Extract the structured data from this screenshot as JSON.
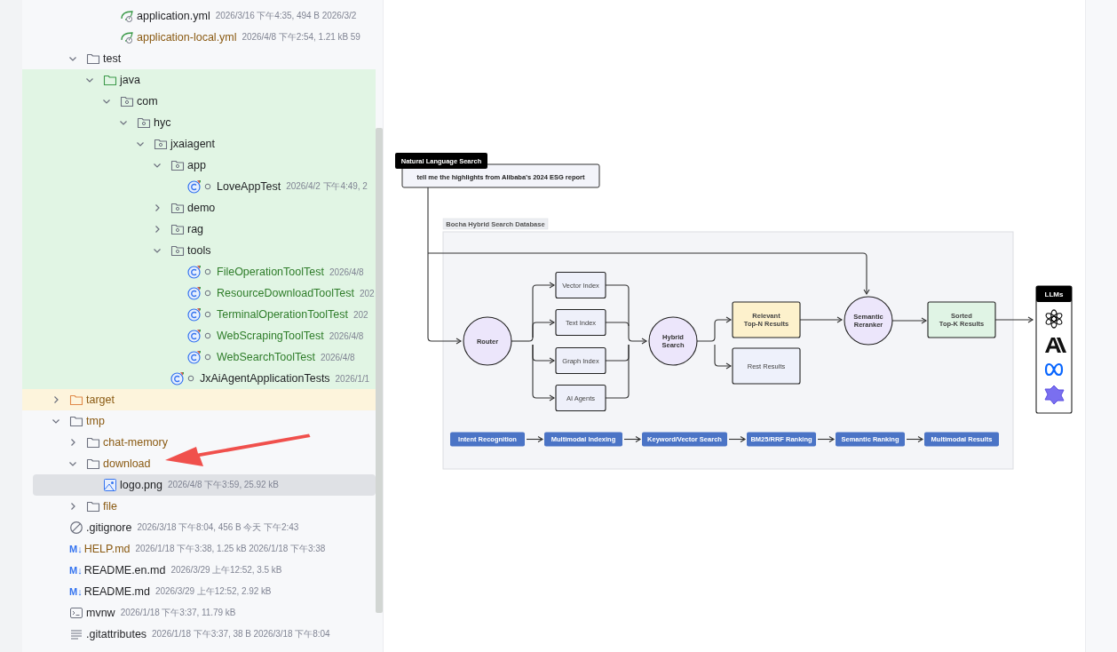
{
  "tree": [
    {
      "children": [
        {
          "children": [
            {
              "children": [
                {
                  "name": "application.yml",
                  "kind": "spring-config",
                  "color": "#1e1f22",
                  "info": "2026/3/16 下午4:35, 494 B 2026/3/2",
                  "selected": false
                },
                {
                  "name": "application-local.yml",
                  "kind": "spring-config",
                  "color": "#8a5a12",
                  "info": "2026/4/8 下午2:54, 1.21 kB 59",
                  "selected": false
                }
              ]
            }
          ]
        },
        {
          "name": "test",
          "kind": "folder",
          "color": "#1e1f22",
          "expanded": true,
          "selected": false,
          "children": [
            {
              "name": "java",
              "kind": "test-root",
              "color": "#1e1f22",
              "expanded": true,
              "selected": false,
              "children": [
                {
                  "name": "com",
                  "kind": "package",
                  "color": "#1e1f22",
                  "expanded": true,
                  "selected": false,
                  "children": [
                    {
                      "name": "hyc",
                      "kind": "package",
                      "color": "#1e1f22",
                      "expanded": true,
                      "selected": false,
                      "children": [
                        {
                          "name": "jxaiagent",
                          "kind": "package",
                          "color": "#1e1f22",
                          "expanded": true,
                          "selected": false,
                          "children": [
                            {
                              "name": "app",
                              "kind": "package",
                              "color": "#1e1f22",
                              "expanded": true,
                              "selected": false,
                              "children": [
                                {
                                  "name": "LoveAppTest",
                                  "kind": "test-class",
                                  "color": "#1e1f22",
                                  "info": "2026/4/2 下午4:49, 2",
                                  "selected": false
                                }
                              ]
                            },
                            {
                              "name": "demo",
                              "kind": "package",
                              "color": "#1e1f22",
                              "expanded": false,
                              "selected": false
                            },
                            {
                              "name": "rag",
                              "kind": "package",
                              "color": "#1e1f22",
                              "expanded": false,
                              "selected": false
                            },
                            {
                              "name": "tools",
                              "kind": "package",
                              "color": "#1e1f22",
                              "expanded": true,
                              "selected": false,
                              "children": [
                                {
                                  "name": "FileOperationToolTest",
                                  "kind": "test-class",
                                  "color": "#2f7d2a",
                                  "info": "2026/4/8",
                                  "selected": false
                                },
                                {
                                  "name": "ResourceDownloadToolTest",
                                  "kind": "test-class",
                                  "color": "#2f7d2a",
                                  "info": "202",
                                  "selected": false
                                },
                                {
                                  "name": "TerminalOperationToolTest",
                                  "kind": "test-class",
                                  "color": "#2f7d2a",
                                  "info": "202",
                                  "selected": false
                                },
                                {
                                  "name": "WebScrapingToolTest",
                                  "kind": "test-class",
                                  "color": "#2f7d2a",
                                  "info": "2026/4/8",
                                  "selected": false
                                },
                                {
                                  "name": "WebSearchToolTest",
                                  "kind": "test-class",
                                  "color": "#2f7d2a",
                                  "info": "2026/4/8",
                                  "selected": false
                                }
                              ]
                            },
                            {
                              "name": "JxAiAgentApplicationTests",
                              "kind": "test-class",
                              "color": "#1e1f22",
                              "info": "2026/1/1",
                              "selected": false
                            }
                          ]
                        }
                      ]
                    }
                  ]
                }
              ]
            }
          ]
        }
      ]
    },
    {
      "name": "target",
      "kind": "excluded-folder",
      "color": "#8a5a12",
      "expanded": false,
      "selected": false
    },
    {
      "name": "tmp",
      "kind": "folder",
      "color": "#8a5a12",
      "expanded": true,
      "selected": false,
      "children": [
        {
          "name": "chat-memory",
          "kind": "folder",
          "color": "#8a5a12",
          "expanded": false,
          "selected": false
        },
        {
          "name": "download",
          "kind": "folder",
          "color": "#8a5a12",
          "expanded": true,
          "selected": false,
          "children": [
            {
              "name": "logo.png",
              "kind": "image",
              "color": "#1e1f22",
              "info": "2026/4/8 下午3:59, 25.92 kB",
              "selected": true
            }
          ]
        },
        {
          "name": "file",
          "kind": "folder",
          "color": "#8a5a12",
          "expanded": false,
          "selected": false
        }
      ]
    },
    {
      "name": ".gitignore",
      "kind": "ignore-file",
      "color": "#1e1f22",
      "info": "2026/3/18 下午8:04, 456 B 今天 下午2:43",
      "selected": false
    },
    {
      "name": "HELP.md",
      "kind": "markdown",
      "badge": "M↓",
      "color": "#8a5a12",
      "info": "2026/1/18 下午3:38, 1.25 kB 2026/1/18 下午3:38",
      "selected": false
    },
    {
      "name": "README.en.md",
      "kind": "markdown",
      "badge": "M↓",
      "color": "#1e1f22",
      "info": "2026/3/29 上午12:52, 3.5 kB",
      "selected": false
    },
    {
      "name": "README.md",
      "kind": "markdown",
      "badge": "M↓",
      "color": "#1e1f22",
      "info": "2026/3/29 上午12:52, 2.92 kB",
      "selected": false
    },
    {
      "name": "mvnw",
      "kind": "terminal",
      "color": "#1e1f22",
      "info": "2026/1/18 下午3:37, 11.79 kB",
      "selected": false
    },
    {
      "name": ".gitattributes",
      "kind": "text",
      "color": "#1e1f22",
      "info": "2026/1/18 下午3:37, 38 B 2026/3/18 下午8:04",
      "selected": false
    }
  ],
  "preview": {
    "diagram": {
      "search_tab": "Natural Language Search",
      "query": "tell me the highlights from Alibaba’s 2024 ESG report",
      "database_label": "Bocha Hybrid Search Database",
      "nodes": [
        {
          "kind": "circle",
          "lines": [
            "Router"
          ],
          "color": "#ece6fb"
        },
        {
          "kind": "box",
          "lines": [
            "Vector Index"
          ],
          "color": "#eef0fa"
        },
        {
          "kind": "box",
          "lines": [
            "Text Index"
          ],
          "color": "#eef0fa"
        },
        {
          "kind": "box",
          "lines": [
            "Graph Index"
          ],
          "color": "#eef0fa"
        },
        {
          "kind": "box",
          "lines": [
            "AI Agents"
          ],
          "color": "#eef0fa"
        },
        {
          "kind": "circle",
          "lines": [
            "Hybrid",
            "Search"
          ],
          "color": "#ece6fb"
        },
        {
          "kind": "box",
          "lines": [
            "Relevant",
            "Top-N Results"
          ],
          "color": "#fdf1cc"
        },
        {
          "kind": "box",
          "lines": [
            "Rest Results"
          ],
          "color": "#eef1fb"
        },
        {
          "kind": "circle",
          "lines": [
            "Semantic",
            "Reranker"
          ],
          "color": "#ece6fb"
        },
        {
          "kind": "box",
          "lines": [
            "Sorted",
            "Top-K Results"
          ],
          "color": "#e0f4e5"
        }
      ],
      "llm_panel": {
        "title": "LLMs"
      },
      "pipeline": [
        "Intent Recognition",
        "Multimodal Indexing",
        "Keyword/Vector Search",
        "BM25/RRF Ranking",
        "Semantic Ranking",
        "Multimodal Results"
      ]
    }
  }
}
